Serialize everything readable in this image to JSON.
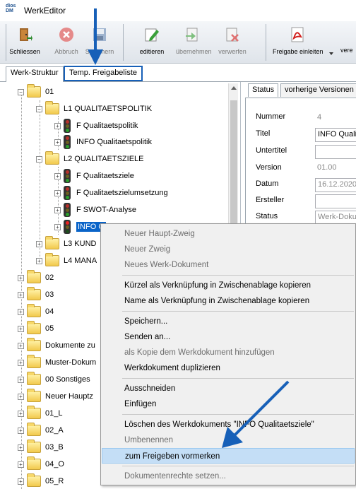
{
  "window": {
    "title": "WerkEditor",
    "logo": "dios DM"
  },
  "toolbar": {
    "buttons": [
      {
        "label": "Schliessen",
        "icon": "door-exit-icon"
      },
      {
        "label": "Abbruch",
        "icon": "cancel-icon"
      },
      {
        "label": "Speichern",
        "icon": "save-icon"
      },
      {
        "label": "editieren",
        "icon": "edit-icon"
      },
      {
        "label": "übernehmen",
        "icon": "accept-icon"
      },
      {
        "label": "verwerfen",
        "icon": "discard-icon"
      },
      {
        "label": "Freigabe einleiten",
        "icon": "pdf-icon"
      },
      {
        "label": "vere",
        "icon": "more-icon"
      }
    ]
  },
  "tabs": [
    "Werk-Struktur",
    "Temp. Freigabeliste"
  ],
  "tree": {
    "root": "01",
    "l1": "L1 QUALITAETSPOLITIK",
    "l1_items": [
      "F Qualitaetspolitik",
      "INFO Qualitaetspolitik"
    ],
    "l2": "L2 QUALITAETSZIELE",
    "l2_items": [
      "F Qualitaetsziele",
      "F Qualitaetszielumsetzung",
      "F SWOT-Analyse",
      "INFO Q"
    ],
    "l3": "L3 KUND",
    "l4": "L4 MANA",
    "folders": [
      "02",
      "03",
      "04",
      "05",
      "Dokumente zu",
      "Muster-Dokum",
      "00 Sonstiges",
      "Neuer Hauptz",
      "01_L",
      "02_A",
      "03_B",
      "04_O",
      "05_R"
    ]
  },
  "panel": {
    "tabs": [
      "Status",
      "vorherige Versionen"
    ],
    "fields": [
      {
        "label": "Nummer",
        "value": "4"
      },
      {
        "label": "Titel",
        "value": "INFO Qualit"
      },
      {
        "label": "Untertitel",
        "value": ""
      },
      {
        "label": "Version",
        "value": "01.00"
      },
      {
        "label": "Datum",
        "value": "16.12.2020"
      },
      {
        "label": "Ersteller",
        "value": ""
      },
      {
        "label": "Status",
        "value": "Werk-Dokum"
      }
    ]
  },
  "context_menu": {
    "items": [
      "Neuer Haupt-Zweig",
      "Neuer Zweig",
      "Neues Werk-Dokument",
      "Kürzel als Verknüpfung in Zwischenablage kopieren",
      "Name als Verknüpfung in Zwischenablage kopieren",
      "Speichern...",
      "Senden an...",
      "als Kopie dem Werkdokument hinzufügen",
      "Werkdokument duplizieren",
      "Ausschneiden",
      "Einfügen",
      "Löschen des Werkdokuments \"INFO Qualitaetsziele\"",
      "Umbenennen",
      "zum Freigeben vormerken",
      "Dokumentenrechte setzen..."
    ]
  },
  "colors": {
    "arrow": "#1760b8",
    "selection": "#0a64c8",
    "menu_highlight": "#c4def6"
  }
}
